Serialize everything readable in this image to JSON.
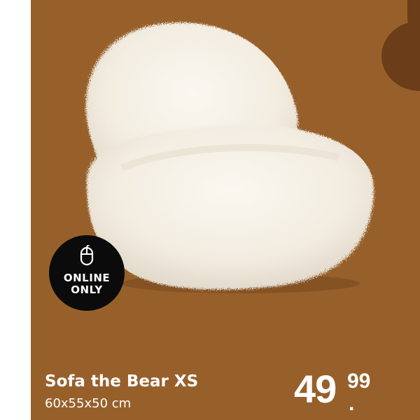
{
  "product": {
    "name": "Sofa the Bear XS",
    "dimensions": "60x55x50 cm",
    "image_alt": "white fluffy bear sofa chair"
  },
  "badge": {
    "line1": "ONLINE",
    "line2": "ONLY",
    "icon": "mouse-icon"
  },
  "price": {
    "main": "49",
    "cents": "99",
    "separator": "."
  },
  "colors": {
    "background": "#97602b",
    "accent_shape": "#6b3d18",
    "badge": "#0b0b0b",
    "text": "#ffffff"
  }
}
